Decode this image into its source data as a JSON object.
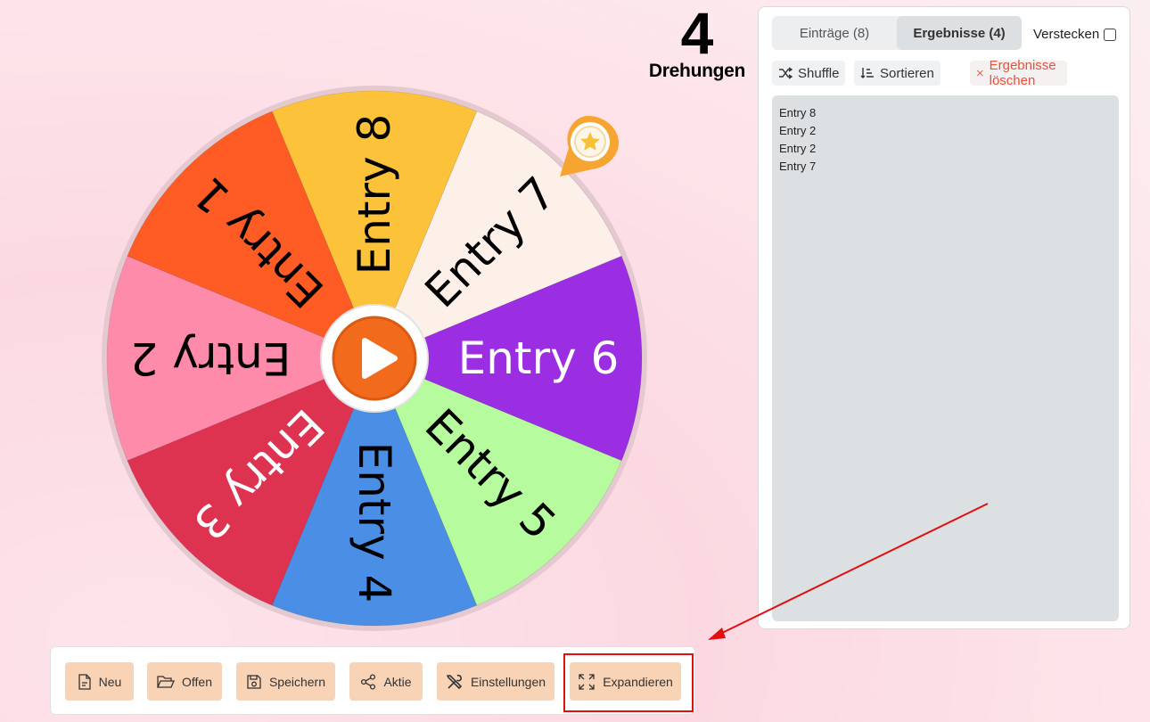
{
  "counter": {
    "value": "4",
    "label": "Drehungen"
  },
  "wheel": {
    "segments": [
      {
        "label": "Entry 6",
        "color": "#9b2ee3",
        "text_color": "#ffffff"
      },
      {
        "label": "Entry 5",
        "color": "#b6fb9d",
        "text_color": "#000000"
      },
      {
        "label": "Entry 4",
        "color": "#4a8fe5",
        "text_color": "#000000"
      },
      {
        "label": "Entry 3",
        "color": "#de3350",
        "text_color": "#ffffff"
      },
      {
        "label": "Entry 2",
        "color": "#ff8bab",
        "text_color": "#000000"
      },
      {
        "label": "Entry 1",
        "color": "#ff5b24",
        "text_color": "#000000"
      },
      {
        "label": "Entry 8",
        "color": "#fcc23a",
        "text_color": "#000000"
      },
      {
        "label": "Entry 7",
        "color": "#fdf0e8",
        "text_color": "#000000"
      }
    ],
    "rim_color": "#e5c9d1",
    "spin_button_color": "#f26b1d",
    "pointer_color": "#f7a531",
    "pointer_icon": "star-icon"
  },
  "panel": {
    "tabs": [
      {
        "label": "Einträge (8)",
        "active": false
      },
      {
        "label": "Ergebnisse (4)",
        "active": true
      }
    ],
    "hide_label": "Verstecken",
    "shuffle_label": "Shuffle",
    "sort_label": "Sortieren",
    "clear_label": "Ergebnisse löschen",
    "results": [
      "Entry 8",
      "Entry 2",
      "Entry 2",
      "Entry 7"
    ]
  },
  "toolbar": {
    "new_label": "Neu",
    "open_label": "Offen",
    "save_label": "Speichern",
    "share_label": "Aktie",
    "settings_label": "Einstellungen",
    "expand_label": "Expandieren"
  },
  "annotation": {
    "color": "#e01010"
  }
}
